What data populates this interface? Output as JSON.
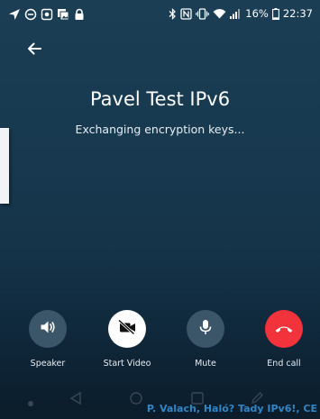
{
  "status_bar": {
    "left_icons": [
      "navigation-arrow-icon",
      "do-not-disturb-icon",
      "screenshot-icon",
      "gallery-icon",
      "lock-icon"
    ],
    "right_icons": [
      "bluetooth-icon",
      "nfc-icon",
      "vibrate-icon",
      "wifi-icon",
      "signal-icon",
      "battery-icon"
    ],
    "battery": "16%",
    "time": "22:37"
  },
  "header": {
    "back_icon": "arrow-left-icon"
  },
  "call": {
    "contact_name": "Pavel Test IPv6",
    "status": "Exchanging encryption keys..."
  },
  "controls": [
    {
      "id": "speaker",
      "label": "Speaker",
      "icon": "speaker-icon",
      "style": "gray"
    },
    {
      "id": "video",
      "label": "Start Video",
      "icon": "video-off-icon",
      "style": "white"
    },
    {
      "id": "mute",
      "label": "Mute",
      "icon": "microphone-icon",
      "style": "gray"
    },
    {
      "id": "end",
      "label": "End call",
      "icon": "phone-hangup-icon",
      "style": "red"
    }
  ],
  "colors": {
    "background_top": "#1b3e54",
    "background_bottom": "#0b1c2a",
    "control_gray": "#3b5569",
    "end_call_red": "#f2333b",
    "watermark_blue": "#2f86c8"
  },
  "watermark": "P. Valach, Haló? Tady IPv6!, CE"
}
